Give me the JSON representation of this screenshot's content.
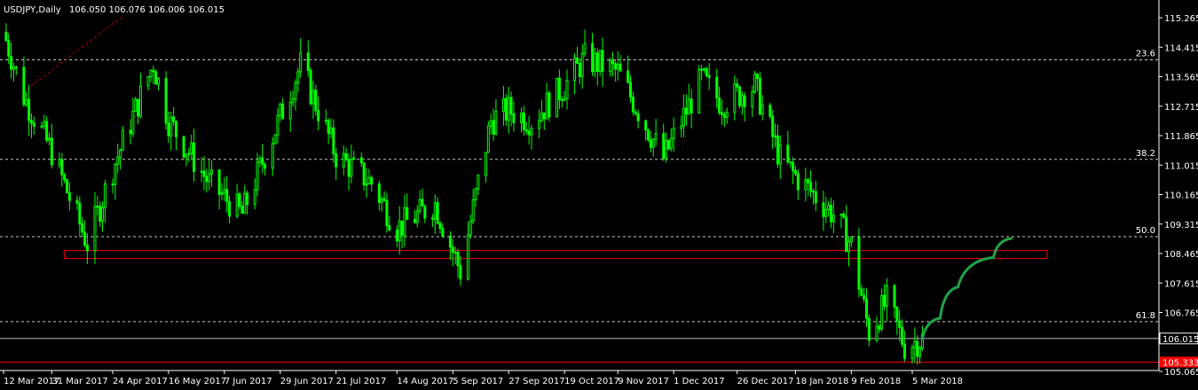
{
  "header": {
    "symbol": "USDJPY,Daily",
    "quote": "106.050 106.076 106.006 106.015"
  },
  "colors": {
    "background": "#000000",
    "candle_bull": "#00ff00",
    "candle_bear": "#00ff00",
    "grid_dashed": "#c8c8c8",
    "zone_outline": "#ff0000",
    "current_price_line": "#c0c0c0",
    "projection": "#1fa34a",
    "trend_dashed": "#c00000",
    "axis_text": "#ffffff",
    "red_tag": "#ff0000"
  },
  "chart_data": {
    "type": "candlestick",
    "title": "USDJPY,Daily",
    "ylim": [
      105.065,
      115.265
    ],
    "y_ticks": [
      "115.265",
      "114.415",
      "113.565",
      "112.715",
      "111.865",
      "111.015",
      "110.165",
      "109.315",
      "108.465",
      "107.615",
      "106.765",
      "105.065"
    ],
    "x_ticks": [
      "12 Mar 2017",
      "31 Mar 2017",
      "24 Apr 2017",
      "16 May 2017",
      "7 Jun 2017",
      "29 Jun 2017",
      "21 Jul 2017",
      "14 Aug 2017",
      "5 Sep 2017",
      "27 Sep 2017",
      "19 Oct 2017",
      "9 Nov 2017",
      "1 Dec 2017",
      "26 Dec 2017",
      "18 Jan 2018",
      "9 Feb 2018",
      "5 Mar 2018"
    ],
    "current_price": "106.015",
    "red_price_tag": "105.333",
    "fib_levels": [
      {
        "label": "23.6",
        "price": 114.05
      },
      {
        "label": "38.2",
        "price": 111.18
      },
      {
        "label": "50.0",
        "price": 108.95
      },
      {
        "label": "61.8",
        "price": 106.5
      }
    ],
    "support_zone": {
      "from_date": "31 Mar 2017",
      "to_date": "5 Mar 2018",
      "top": 108.55,
      "bottom": 108.32
    },
    "bottom_zone": {
      "from_date": "12 Mar 2017",
      "to_date": "5 Mar 2018",
      "price": 105.33
    },
    "close_path": [
      [
        "12 Mar 2017",
        114.85
      ],
      [
        "20 Mar 2017",
        113.0
      ],
      [
        "31 Mar 2017",
        111.4
      ],
      [
        "14 Apr 2017",
        108.75
      ],
      [
        "24 Apr 2017",
        110.9
      ],
      [
        "10 May 2017",
        113.95
      ],
      [
        "16 May 2017",
        112.3
      ],
      [
        "1 Jun 2017",
        110.5
      ],
      [
        "14 Jun 2017",
        109.6
      ],
      [
        "23 Jun 2017",
        111.3
      ],
      [
        "7 Jul 2017",
        113.9
      ],
      [
        "21 Jul 2017",
        111.3
      ],
      [
        "4 Aug 2017",
        110.5
      ],
      [
        "14 Aug 2017",
        109.2
      ],
      [
        "29 Aug 2017",
        109.9
      ],
      [
        "8 Sep 2017",
        107.95
      ],
      [
        "20 Sep 2017",
        112.3
      ],
      [
        "27 Sep 2017",
        112.6
      ],
      [
        "6 Oct 2017",
        112.3
      ],
      [
        "19 Oct 2017",
        113.3
      ],
      [
        "27 Oct 2017",
        114.1
      ],
      [
        "9 Nov 2017",
        113.7
      ],
      [
        "27 Nov 2017",
        111.2
      ],
      [
        "12 Dec 2017",
        113.5
      ],
      [
        "20 Dec 2017",
        112.8
      ],
      [
        "2 Jan 2018",
        113.3
      ],
      [
        "12 Jan 2018",
        111.2
      ],
      [
        "18 Jan 2018",
        110.7
      ],
      [
        "2 Feb 2018",
        109.6
      ],
      [
        "9 Feb 2018",
        108.7
      ],
      [
        "16 Feb 2018",
        106.2
      ],
      [
        "23 Feb 2018",
        107.1
      ],
      [
        "2 Mar 2018",
        105.8
      ],
      [
        "9 Mar 2018",
        106.0
      ]
    ],
    "projection_path": [
      [
        "9 Mar 2018",
        106.0
      ],
      [
        "16 Mar 2018",
        106.6
      ],
      [
        "23 Mar 2018",
        107.5
      ],
      [
        "6 Apr 2018",
        108.35
      ],
      [
        "13 Apr 2018",
        108.9
      ]
    ],
    "grid": false
  }
}
